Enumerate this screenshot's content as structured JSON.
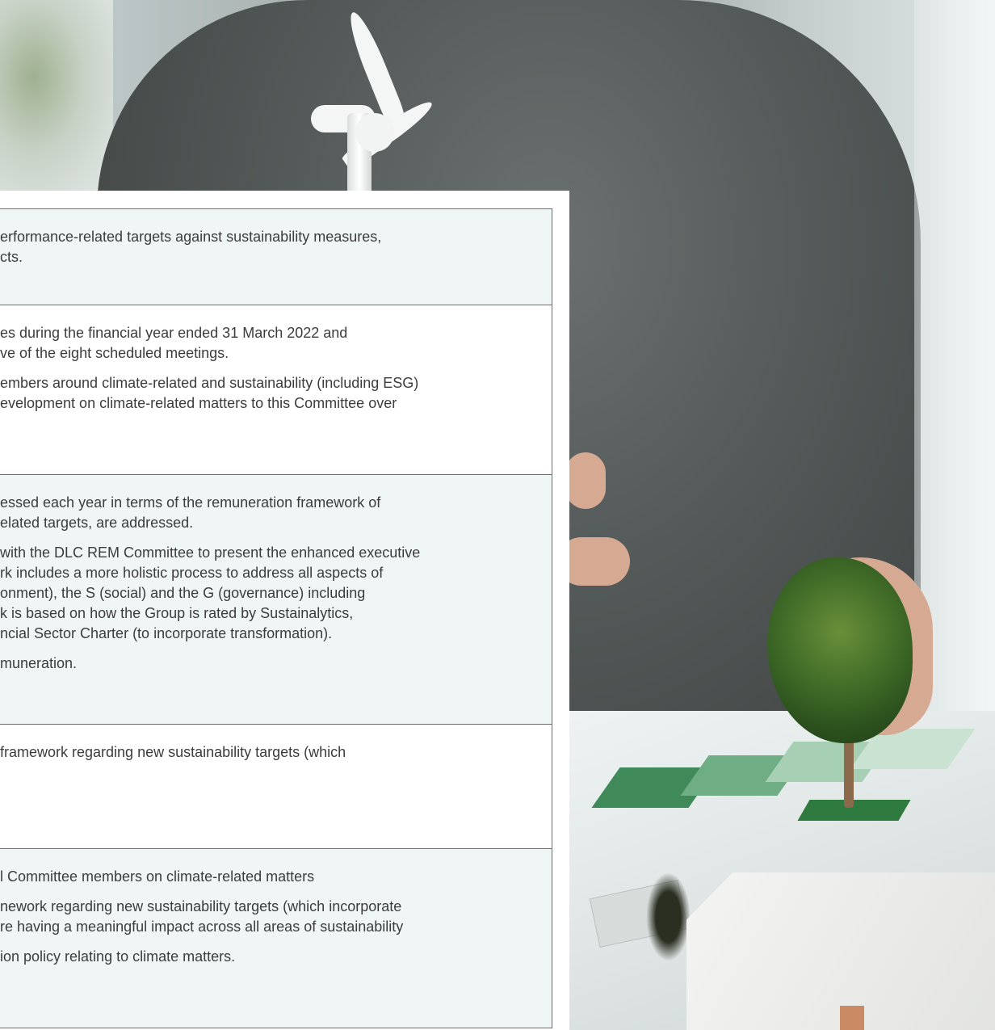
{
  "rows": [
    {
      "paragraphs": [
        [
          "erformance-related targets against sustainability measures,",
          "cts."
        ]
      ]
    },
    {
      "paragraphs": [
        [
          "es during the financial year ended 31 March 2022 and",
          "ve of the eight scheduled meetings."
        ],
        [
          "embers around climate-related and sustainability (including ESG)",
          "evelopment on climate-related matters to this Committee over"
        ]
      ]
    },
    {
      "paragraphs": [
        [
          "essed each year in terms of the remuneration framework of",
          "elated targets, are addressed."
        ],
        [
          "with the DLC REM Committee to present the enhanced executive",
          "rk includes a more holistic process to address all aspects of",
          "onment), the S (social) and the G (governance) including",
          "k is based on how the Group is rated by Sustainalytics,",
          "ncial Sector Charter (to incorporate transformation)."
        ],
        [
          "muneration."
        ]
      ]
    },
    {
      "paragraphs": [
        [
          "framework regarding new sustainability targets (which"
        ]
      ]
    },
    {
      "paragraphs": [
        [
          "l Committee members on climate-related matters"
        ],
        [
          "nework regarding new sustainability targets (which incorporate",
          "re having a meaningful impact across all areas of sustainability"
        ],
        [
          "ion policy relating to climate matters."
        ]
      ]
    }
  ],
  "colors": {
    "row_tint": "#f0f6f6",
    "border": "#6d6d6d",
    "text": "#3c3c3c"
  }
}
